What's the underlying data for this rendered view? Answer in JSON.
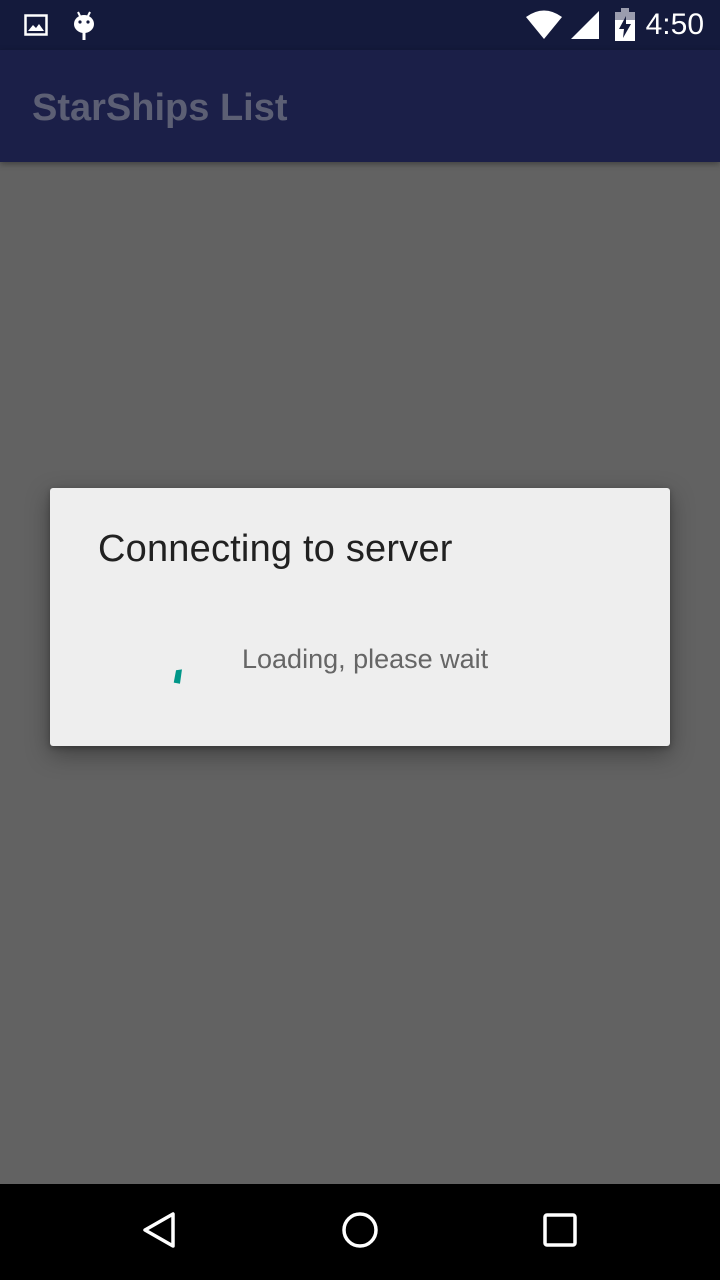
{
  "status_bar": {
    "time": "4:50",
    "icons": [
      "image-notification-icon",
      "android-debug-icon",
      "wifi-icon",
      "cell-signal-icon",
      "battery-charging-icon"
    ]
  },
  "app_bar": {
    "title": "StarShips List"
  },
  "dialog": {
    "title": "Connecting to server",
    "message": "Loading, please wait",
    "spinner_color": "#009688"
  },
  "nav_bar": {
    "buttons": [
      "back-icon",
      "home-icon",
      "recents-icon"
    ]
  },
  "colors": {
    "status_bar_bg": "#141a3c",
    "app_bar_bg": "#1b1f48",
    "scrim_bg": "#626262",
    "dialog_bg": "#eeeeee"
  }
}
